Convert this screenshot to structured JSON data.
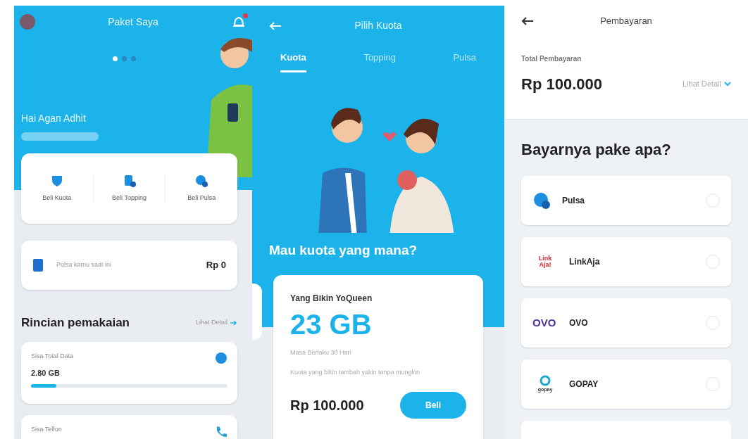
{
  "screens": [
    {
      "kind": "home",
      "title": "Paket Saya",
      "carousel": [
        {
          "selected": true
        },
        {
          "selected": false
        },
        {
          "selected": false
        }
      ],
      "greeting": "Hai Agan Adhit",
      "notification": true,
      "shortcuts": [
        {
          "kind": "shield",
          "label": "Beli Kuota"
        },
        {
          "kind": "doc",
          "label": "Beli Topping"
        },
        {
          "kind": "coin",
          "label": "Beli Pulsa"
        }
      ],
      "balance": {
        "label": "Pulsa kamu saat ini",
        "value": "Rp 0"
      },
      "usage": {
        "title": "Rincian pemakaian",
        "link": "Lihat Detail",
        "items": [
          {
            "kind": "data",
            "label": "Sisa Total Data",
            "value": "2.80 GB",
            "level": 0.13
          },
          {
            "kind": "call",
            "label": "Sisa Telfon"
          }
        ]
      }
    },
    {
      "kind": "quota",
      "title": "Pilih Kuota",
      "tabs": [
        {
          "label": "Kuota",
          "selected": true
        },
        {
          "label": "Topping",
          "selected": false
        },
        {
          "label": "Pulsa",
          "selected": false
        }
      ],
      "headline": "Mau kuota yang mana?",
      "offer": {
        "name": "Yang Bikin YoQueen",
        "size": "23 GB",
        "validity": "Masa Berlaku 30 Hari",
        "description": "Kuota yang bikin tambah yakin tanpa mungkin",
        "price": "Rp 100.000",
        "button": "Beli"
      }
    },
    {
      "kind": "payment",
      "title": "Pembayaran",
      "total_label": "Total Pembayaran",
      "total": "Rp 100.000",
      "detail_link": "Lihat Detail",
      "question": "Bayarnya pake apa?",
      "methods": [
        {
          "kind": "pulsa",
          "name": "Pulsa",
          "selected": false
        },
        {
          "kind": "linkaja",
          "logo": "Link Aja!",
          "name": "LinkAja",
          "selected": false
        },
        {
          "kind": "ovo",
          "logo": "OVO",
          "name": "OVO",
          "selected": false
        },
        {
          "kind": "gopay",
          "logo": "gopay",
          "name": "GOPAY",
          "selected": false
        }
      ]
    }
  ]
}
